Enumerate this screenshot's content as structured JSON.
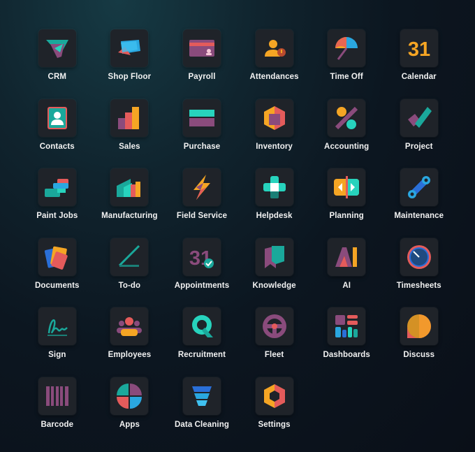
{
  "apps": [
    {
      "label": "CRM",
      "icon": "crm-icon"
    },
    {
      "label": "Shop Floor",
      "icon": "shop-floor-icon"
    },
    {
      "label": "Payroll",
      "icon": "payroll-icon"
    },
    {
      "label": "Attendances",
      "icon": "attendances-icon"
    },
    {
      "label": "Time Off",
      "icon": "time-off-icon"
    },
    {
      "label": "Calendar",
      "icon": "calendar-icon",
      "glyph": "31"
    },
    {
      "label": "Contacts",
      "icon": "contacts-icon"
    },
    {
      "label": "Sales",
      "icon": "sales-icon"
    },
    {
      "label": "Purchase",
      "icon": "purchase-icon"
    },
    {
      "label": "Inventory",
      "icon": "inventory-icon"
    },
    {
      "label": "Accounting",
      "icon": "accounting-icon"
    },
    {
      "label": "Project",
      "icon": "project-icon"
    },
    {
      "label": "Paint Jobs",
      "icon": "paint-jobs-icon"
    },
    {
      "label": "Manufacturing",
      "icon": "manufacturing-icon"
    },
    {
      "label": "Field Service",
      "icon": "field-service-icon"
    },
    {
      "label": "Helpdesk",
      "icon": "helpdesk-icon"
    },
    {
      "label": "Planning",
      "icon": "planning-icon"
    },
    {
      "label": "Maintenance",
      "icon": "maintenance-icon"
    },
    {
      "label": "Documents",
      "icon": "documents-icon"
    },
    {
      "label": "To-do",
      "icon": "to-do-icon"
    },
    {
      "label": "Appointments",
      "icon": "appointments-icon",
      "glyph": "31"
    },
    {
      "label": "Knowledge",
      "icon": "knowledge-icon"
    },
    {
      "label": "AI",
      "icon": "ai-icon",
      "glyph": "AI"
    },
    {
      "label": "Timesheets",
      "icon": "timesheets-icon"
    },
    {
      "label": "Sign",
      "icon": "sign-icon"
    },
    {
      "label": "Employees",
      "icon": "employees-icon"
    },
    {
      "label": "Recruitment",
      "icon": "recruitment-icon"
    },
    {
      "label": "Fleet",
      "icon": "fleet-icon"
    },
    {
      "label": "Dashboards",
      "icon": "dashboards-icon"
    },
    {
      "label": "Discuss",
      "icon": "discuss-icon"
    },
    {
      "label": "Barcode",
      "icon": "barcode-icon"
    },
    {
      "label": "Apps",
      "icon": "apps-icon"
    },
    {
      "label": "Data Cleaning",
      "icon": "data-cleaning-icon"
    },
    {
      "label": "Settings",
      "icon": "settings-icon"
    }
  ],
  "colors": {
    "teal": "#1aa89b",
    "purple": "#8a4b7c",
    "orange": "#f5a524",
    "blue": "#2aa7e0",
    "red": "#e45b5b",
    "tile": "#1f2329"
  }
}
